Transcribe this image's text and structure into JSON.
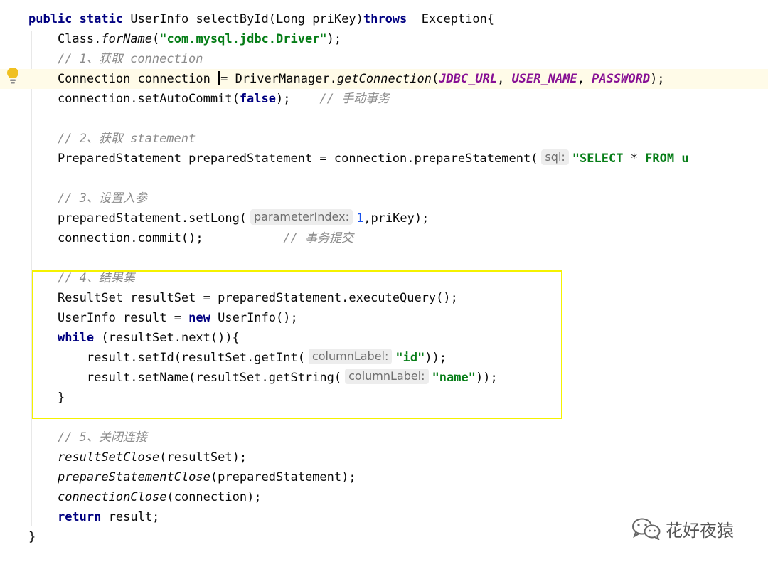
{
  "editor": {
    "lines": [
      {
        "tokens": [
          {
            "t": "public",
            "c": "kw"
          },
          {
            "t": " "
          },
          {
            "t": "static",
            "c": "kw"
          },
          {
            "t": " UserInfo selectById(Long priKey)"
          },
          {
            "t": "throws",
            "c": "kw"
          },
          {
            "t": "  Exception{"
          }
        ]
      },
      {
        "tokens": [
          {
            "t": "    Class."
          },
          {
            "t": "forName",
            "c": "mth"
          },
          {
            "t": "("
          },
          {
            "t": "\"com.mysql.jdbc.Driver\"",
            "c": "str"
          },
          {
            "t": ");"
          }
        ]
      },
      {
        "tokens": [
          {
            "t": "    "
          },
          {
            "t": "// 1、获取 connection",
            "c": "cmt"
          }
        ]
      },
      {
        "highlight": true,
        "tokens": [
          {
            "t": "    Connection connection "
          },
          {
            "caret": true
          },
          {
            "t": "= DriverManager."
          },
          {
            "t": "getConnection",
            "c": "mth"
          },
          {
            "t": "("
          },
          {
            "t": "JDBC_URL",
            "c": "const"
          },
          {
            "t": ", "
          },
          {
            "t": "USER_NAME",
            "c": "const"
          },
          {
            "t": ", "
          },
          {
            "t": "PASSWORD",
            "c": "const"
          },
          {
            "t": ");"
          }
        ]
      },
      {
        "tokens": [
          {
            "t": "    connection.setAutoCommit("
          },
          {
            "t": "false",
            "c": "kw"
          },
          {
            "t": ");    "
          },
          {
            "t": "// 手动事务",
            "c": "cmt"
          }
        ]
      },
      {
        "tokens": []
      },
      {
        "tokens": [
          {
            "t": "    "
          },
          {
            "t": "// 2、获取 statement",
            "c": "cmt"
          }
        ]
      },
      {
        "tokens": [
          {
            "t": "    PreparedStatement preparedStatement = connection.prepareStatement("
          },
          {
            "hint": "sql:"
          },
          {
            "t": "\"SELECT ",
            "c": "str"
          },
          {
            "t": "* "
          },
          {
            "t": "FROM u",
            "c": "str"
          }
        ]
      },
      {
        "tokens": []
      },
      {
        "tokens": [
          {
            "t": "    "
          },
          {
            "t": "// 3、设置入参",
            "c": "cmt"
          }
        ]
      },
      {
        "tokens": [
          {
            "t": "    preparedStatement.setLong("
          },
          {
            "hint": "parameterIndex:"
          },
          {
            "t": "1",
            "c": "num"
          },
          {
            "t": ",priKey);"
          }
        ]
      },
      {
        "tokens": [
          {
            "t": "    connection.commit();           "
          },
          {
            "t": "// 事务提交",
            "c": "cmt"
          }
        ]
      },
      {
        "tokens": []
      },
      {
        "tokens": [
          {
            "t": "    "
          },
          {
            "t": "// 4、结果集",
            "c": "cmt"
          }
        ]
      },
      {
        "tokens": [
          {
            "t": "    ResultSet resultSet = preparedStatement.executeQuery();"
          }
        ]
      },
      {
        "tokens": [
          {
            "t": "    UserInfo result = "
          },
          {
            "t": "new",
            "c": "kw"
          },
          {
            "t": " UserInfo();"
          }
        ]
      },
      {
        "tokens": [
          {
            "t": "    "
          },
          {
            "t": "while",
            "c": "kw"
          },
          {
            "t": " (resultSet.next()){"
          }
        ]
      },
      {
        "tokens": [
          {
            "t": "        result.setId(resultSet.getInt("
          },
          {
            "hint": "columnLabel:"
          },
          {
            "t": "\"id\"",
            "c": "str"
          },
          {
            "t": "));"
          }
        ]
      },
      {
        "tokens": [
          {
            "t": "        result.setName(resultSet.getString("
          },
          {
            "hint": "columnLabel:"
          },
          {
            "t": "\"name\"",
            "c": "str"
          },
          {
            "t": "));"
          }
        ]
      },
      {
        "tokens": [
          {
            "t": "    }"
          }
        ]
      },
      {
        "tokens": []
      },
      {
        "tokens": [
          {
            "t": "    "
          },
          {
            "t": "// 5、关闭连接",
            "c": "cmt"
          }
        ]
      },
      {
        "tokens": [
          {
            "t": "    "
          },
          {
            "t": "resultSetClose",
            "c": "mth"
          },
          {
            "t": "(resultSet);"
          }
        ]
      },
      {
        "tokens": [
          {
            "t": "    "
          },
          {
            "t": "prepareStatementClose",
            "c": "mth"
          },
          {
            "t": "(preparedStatement);"
          }
        ]
      },
      {
        "tokens": [
          {
            "t": "    "
          },
          {
            "t": "connectionClose",
            "c": "mth"
          },
          {
            "t": "(connection);"
          }
        ]
      },
      {
        "tokens": [
          {
            "t": "    "
          },
          {
            "t": "return",
            "c": "kw"
          },
          {
            "t": " result;"
          }
        ]
      },
      {
        "tokens": [
          {
            "t": "}"
          }
        ]
      }
    ]
  },
  "gutter": {
    "bulb_icon": "lightbulb-icon",
    "bulb_color": "#f0c020"
  },
  "highlight_box": {
    "color": "#f5f200"
  },
  "watermark": {
    "icon": "wechat-icon",
    "text": "花好夜猿"
  }
}
